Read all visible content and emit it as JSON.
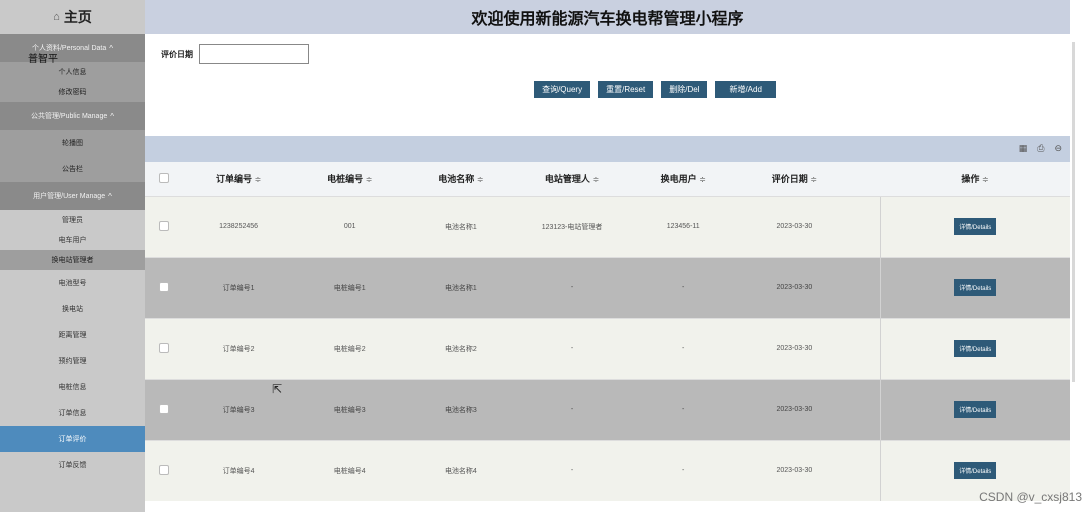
{
  "sidebar": {
    "home_icon": "⌂",
    "home_label": "主页",
    "overlay_text": "普智平",
    "groups": [
      {
        "label": "个人资料/Personal Data",
        "chevron": "^",
        "items": [
          "个人信息",
          "修改密码"
        ]
      },
      {
        "label": "公共管理/Public Manage",
        "chevron": "^",
        "items": [
          "轮播图",
          "公告栏"
        ]
      },
      {
        "label": "用户管理/User Manage",
        "chevron": "^",
        "items": [
          "管理员",
          "电车用户",
          "换电站管理者"
        ]
      }
    ],
    "other_items": [
      "电池型号",
      "换电站",
      "距离管理",
      "预约管理",
      "电桩信息",
      "订单信息",
      "订单评价",
      "订单反馈"
    ],
    "active_item": "订单评价"
  },
  "header": {
    "title": "欢迎使用新能源汽车换电帮管理小程序"
  },
  "search": {
    "label": "评价日期",
    "value": "",
    "buttons": [
      "查询/Query",
      "重置/Reset",
      "删除/Del",
      "新增/Add"
    ]
  },
  "toolbar": {
    "icons": [
      "grid-icon",
      "print-icon",
      "export-icon"
    ]
  },
  "table": {
    "columns": [
      "订单编号",
      "电桩编号",
      "电池名称",
      "电站管理人",
      "换电用户",
      "评价日期",
      "操作"
    ],
    "sort_glyph": "≑",
    "rows": [
      [
        "1238252456",
        "001",
        "电池名称1",
        "123123-电站管理者",
        "123456-11",
        "2023-03-30"
      ],
      [
        "订单编号1",
        "电桩编号1",
        "电池名称1",
        "-",
        "-",
        "2023-03-30"
      ],
      [
        "订单编号2",
        "电桩编号2",
        "电池名称2",
        "-",
        "-",
        "2023-03-30"
      ],
      [
        "订单编号3",
        "电桩编号3",
        "电池名称3",
        "-",
        "-",
        "2023-03-30"
      ],
      [
        "订单编号4",
        "电桩编号4",
        "电池名称4",
        "-",
        "-",
        "2023-03-30"
      ]
    ],
    "detail_button": "详情/Details"
  },
  "watermark": "CSDN @v_cxsj813"
}
